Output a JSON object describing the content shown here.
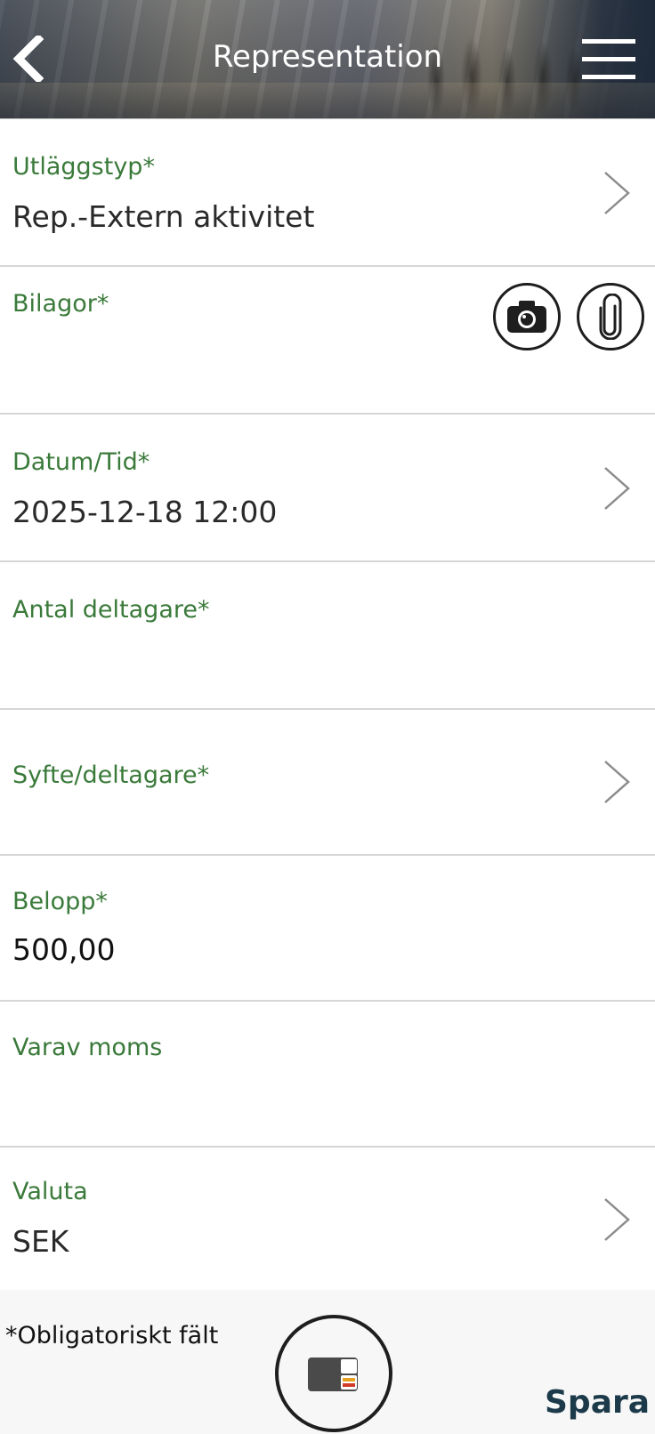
{
  "header": {
    "title": "Representation",
    "back_icon": "chevron-left-icon",
    "menu_icon": "hamburger-menu-icon"
  },
  "fields": {
    "expense_type": {
      "label": "Utläggstyp*",
      "value": "Rep.-Extern aktivitet"
    },
    "attachments": {
      "label": "Bilagor*",
      "camera_icon": "camera-icon",
      "attach_icon": "paperclip-icon"
    },
    "datetime": {
      "label": "Datum/Tid*",
      "value": "2025-12-18 12:00"
    },
    "participants_count": {
      "label": "Antal deltagare*",
      "value": ""
    },
    "purpose": {
      "label": "Syfte/deltagare*"
    },
    "amount": {
      "label": "Belopp*",
      "value": "500,00"
    },
    "vat": {
      "label": "Varav moms",
      "value": ""
    },
    "currency": {
      "label": "Valuta",
      "value": "SEK"
    }
  },
  "footer": {
    "required_note": "*Obligatoriskt fält",
    "card_icon": "credit-card-icon",
    "save_label": "Spara"
  },
  "colors": {
    "label_green": "#3a7a3a",
    "save_text": "#1c3a4a",
    "divider": "#d6d6d6"
  }
}
